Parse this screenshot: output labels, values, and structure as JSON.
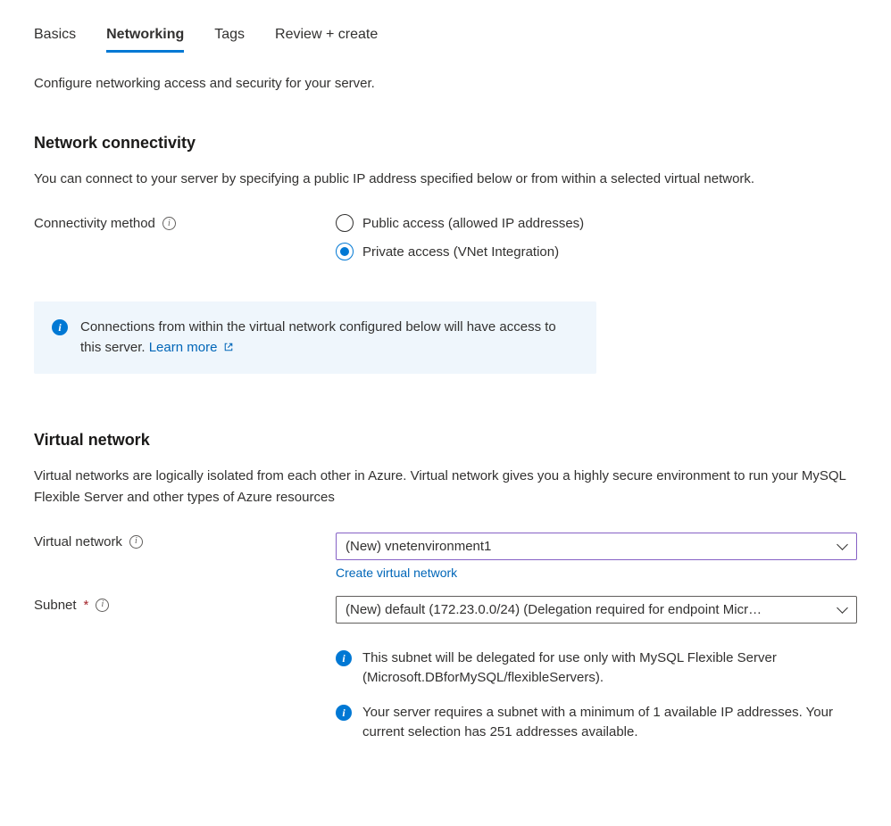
{
  "tabs": {
    "basics": "Basics",
    "networking": "Networking",
    "tags": "Tags",
    "review": "Review + create"
  },
  "page_description": "Configure networking access and security for your server.",
  "network_connectivity": {
    "heading": "Network connectivity",
    "description": "You can connect to your server by specifying a public IP address specified below or from within a selected virtual network.",
    "label": "Connectivity method",
    "option_public": "Public access (allowed IP addresses)",
    "option_private": "Private access (VNet Integration)"
  },
  "banner": {
    "text": "Connections from within the virtual network configured below will have access to this server. ",
    "link": "Learn more"
  },
  "virtual_network": {
    "heading": "Virtual network",
    "description": "Virtual networks are logically isolated from each other in Azure. Virtual network gives you a highly secure environment to run your MySQL Flexible Server and other types of Azure resources",
    "vnet_label": "Virtual network",
    "vnet_value": "(New) vnetenvironment1",
    "create_link": "Create virtual network",
    "subnet_label": "Subnet",
    "subnet_value": "(New) default (172.23.0.0/24) (Delegation required for endpoint Micr…",
    "info_delegate": "This subnet will be delegated for use only with MySQL Flexible Server (Microsoft.DBforMySQL/flexibleServers).",
    "info_ip": "Your server requires a subnet with a minimum of 1 available IP addresses. Your current selection has 251 addresses available."
  }
}
